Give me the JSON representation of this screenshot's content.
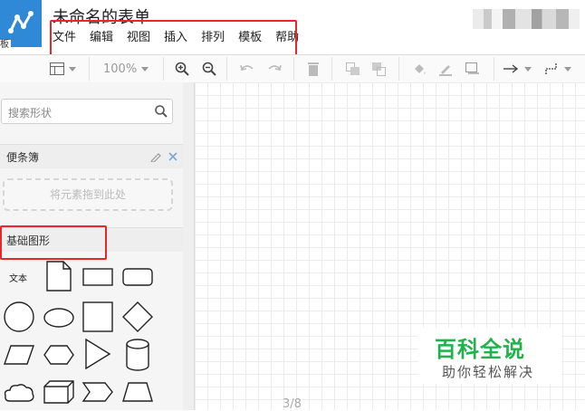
{
  "app": {
    "title": "未命名的表单",
    "logo_tag": "板"
  },
  "menu": [
    "文件",
    "编辑",
    "视图",
    "插入",
    "排列",
    "模板",
    "帮助"
  ],
  "toolbar": {
    "zoom": "100%"
  },
  "sidebar": {
    "search_placeholder": "搜索形状",
    "notes_title": "便条簿",
    "drop_hint": "将元素拖到此处",
    "basic_title": "基础图形",
    "text_shape_label": "文本"
  },
  "canvas": {
    "page_indicator": "3/8"
  },
  "watermark": {
    "title": "百科全说",
    "subtitle": "助你轻松解决"
  },
  "colors": {
    "brand": "#2f89d6",
    "highlight": "#e8262b",
    "watermark": "#22b14c"
  }
}
